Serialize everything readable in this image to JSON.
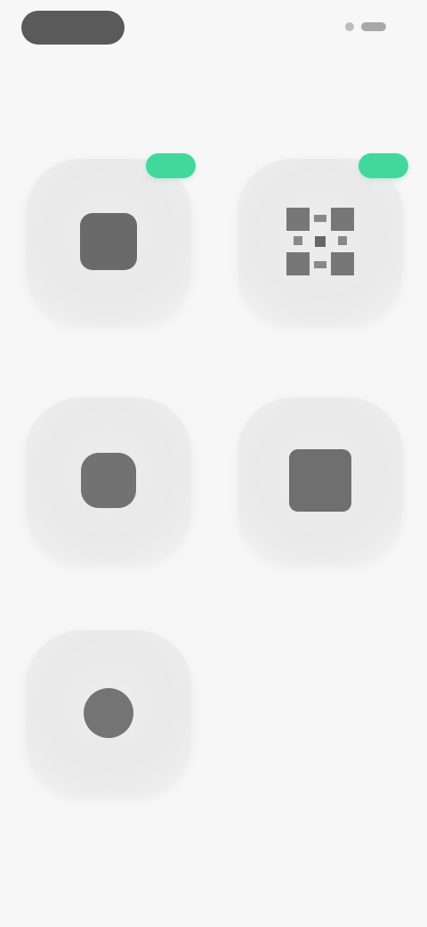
{
  "header": {
    "back_label": "",
    "title": "",
    "status_text": ""
  },
  "tiles": [
    {
      "label": "",
      "badge": "",
      "icon": "square-icon"
    },
    {
      "label": "",
      "badge": "",
      "icon": "qr-grid-icon"
    },
    {
      "label": "",
      "icon": "rounded-square-icon"
    },
    {
      "label": "",
      "icon": "square-dark-icon"
    },
    {
      "label": "",
      "icon": "circle-icon"
    }
  ],
  "colors": {
    "background": "#f7f7f7",
    "tile": "#e9e9e9",
    "text": "#6c6c6c",
    "accent": "#43d89b",
    "dark": "#5a5a5a"
  }
}
